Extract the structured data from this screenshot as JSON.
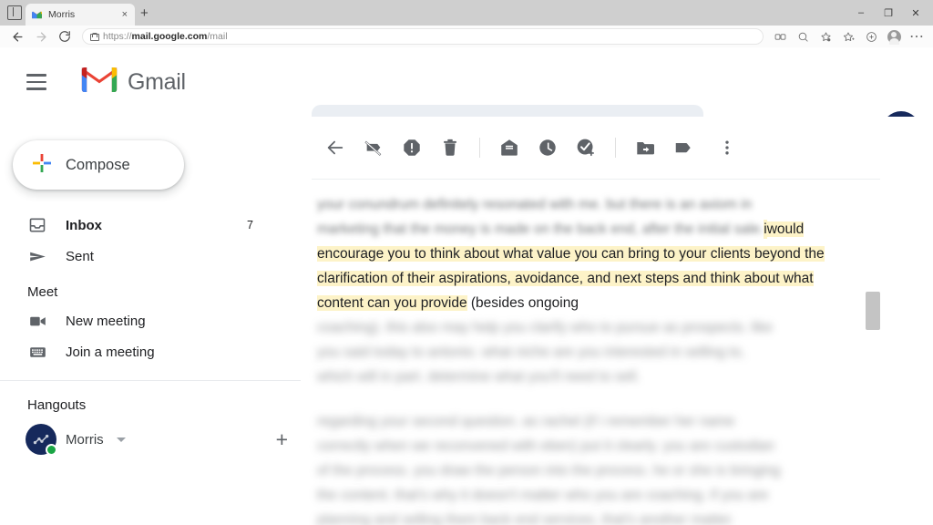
{
  "browser": {
    "tab": {
      "title": "Morris",
      "favicon": "gmail-favicon",
      "close_label": "×"
    },
    "new_tab_label": "+",
    "window_controls": {
      "minimize": "–",
      "maximize": "❐",
      "close": "✕"
    },
    "nav": {
      "back": "←",
      "forward": "→",
      "reload": "⟳"
    },
    "url": {
      "scheme": "https://",
      "host": "mail.google.com",
      "path": "/mail",
      "full": "https://mail.google.com/mail"
    },
    "actions": [
      {
        "name": "split-screen-icon",
        "glyph": "◫"
      },
      {
        "name": "zoom-icon",
        "glyph": "⚲"
      },
      {
        "name": "favorites-settings-icon",
        "glyph": "☆"
      },
      {
        "name": "add-favorite-icon",
        "glyph": "☆"
      },
      {
        "name": "collections-icon",
        "glyph": "⊕"
      },
      {
        "name": "profile-icon",
        "glyph": ""
      },
      {
        "name": "browser-settings-icon",
        "glyph": "⋯"
      }
    ]
  },
  "header": {
    "menu_label": "Main menu",
    "brand": "Gmail",
    "search": {
      "value": "",
      "placeholder": ""
    },
    "help_label": "?",
    "icons": {
      "help": "help-icon",
      "settings": "gear-icon",
      "apps": "apps-grid-icon"
    },
    "avatar": {
      "name": "Morris",
      "bg": "#16295c"
    }
  },
  "sidebar": {
    "compose": {
      "label": "Compose"
    },
    "items": [
      {
        "label": "Inbox",
        "icon": "inbox-icon",
        "count": "7",
        "active": true
      },
      {
        "label": "Sent",
        "icon": "sent-icon",
        "count": "",
        "active": false
      }
    ],
    "meet": {
      "title": "Meet",
      "items": [
        {
          "label": "New meeting",
          "icon": "video-camera-icon"
        },
        {
          "label": "Join a meeting",
          "icon": "keyboard-icon"
        }
      ]
    },
    "hangouts": {
      "title": "Hangouts",
      "user": "Morris",
      "status": "online",
      "add_label": "+"
    }
  },
  "mail": {
    "toolbar": [
      {
        "name": "back-to-inbox-button",
        "icon": "arrow-left-icon"
      },
      {
        "name": "archive-button",
        "icon": "archive-icon"
      },
      {
        "name": "report-spam-button",
        "icon": "report-spam-icon"
      },
      {
        "name": "delete-button",
        "icon": "trash-icon"
      },
      {
        "name": "mark-unread-button",
        "icon": "envelope-icon"
      },
      {
        "name": "snooze-button",
        "icon": "clock-icon"
      },
      {
        "name": "add-to-tasks-button",
        "icon": "task-add-icon"
      },
      {
        "name": "move-to-button",
        "icon": "folder-move-icon"
      },
      {
        "name": "labels-button",
        "icon": "label-tag-icon"
      },
      {
        "name": "more-options-button",
        "icon": "more-vertical-icon"
      }
    ],
    "body": {
      "p1_blurred_line1": "your conundrum definitely resonated with me. but there is an axiom in",
      "p1_blurred_line2": "marketing that the money is made on the back end, after the initial sale.",
      "p1_highlight_start": "i",
      "p1_highlighted": "would encourage you to think about what value you can bring to your clients beyond the clarification of their aspirations, avoidance, and next steps and think about what content can you provide",
      "p1_tail": " (besides ongoing",
      "p1_blurred_line3": "coaching). this also may help you clarify who to pursue as prospects. like",
      "p1_blurred_line4": "you said today to antonio. what niche are you interested in selling to,",
      "p1_blurred_line5": "which will in part. determine what you'll need to sell.",
      "p2_blurred_line1": "regarding your second question. as rachel (if i remember her name",
      "p2_blurred_line2": "correctly when we reconvened with eben) put it clearly. you are custodian",
      "p2_blurred_line3": "of the process. you draw the person into the process. he or she is bringing",
      "p2_blurred_line4": "the content. that's why it doesn't matter who you are coaching. if you are",
      "p2_blurred_line5": "planning and selling them back end services, that's another matter."
    },
    "highlight_color": "#fdf3c8"
  }
}
